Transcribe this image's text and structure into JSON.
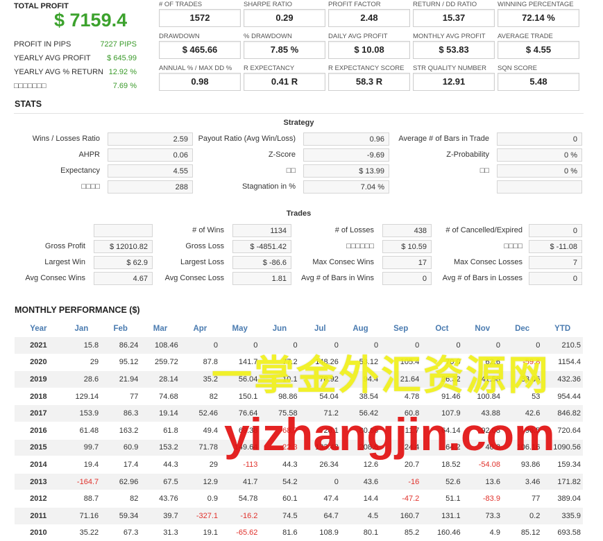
{
  "summary": {
    "total_profit_label": "TOTAL PROFIT",
    "total_profit_value": "$ 7159.4",
    "rows": [
      {
        "label": "PROFIT IN PIPS",
        "value": "7227 PIPS"
      },
      {
        "label": "YEARLY AVG PROFIT",
        "value": "$ 645.99"
      },
      {
        "label": "YEARLY AVG % RETURN",
        "value": "12.92 %"
      },
      {
        "label": "□□□□□□□",
        "value": "7.69 %"
      }
    ]
  },
  "metrics": [
    {
      "label": "# OF TRADES",
      "value": "1572"
    },
    {
      "label": "SHARPE RATIO",
      "value": "0.29"
    },
    {
      "label": "PROFIT FACTOR",
      "value": "2.48"
    },
    {
      "label": "RETURN / DD RATIO",
      "value": "15.37"
    },
    {
      "label": "WINNING PERCENTAGE",
      "value": "72.14 %"
    },
    {
      "label": "DRAWDOWN",
      "value": "$ 465.66"
    },
    {
      "label": "% DRAWDOWN",
      "value": "7.85 %"
    },
    {
      "label": "DAILY AVG PROFIT",
      "value": "$ 10.08"
    },
    {
      "label": "MONTHLY AVG PROFIT",
      "value": "$ 53.83"
    },
    {
      "label": "AVERAGE TRADE",
      "value": "$ 4.55"
    },
    {
      "label": "ANNUAL % / MAX DD %",
      "value": "0.98"
    },
    {
      "label": "R EXPECTANCY",
      "value": "0.41 R"
    },
    {
      "label": "R EXPECTANCY SCORE",
      "value": "58.3 R"
    },
    {
      "label": "STR QUALITY NUMBER",
      "value": "12.91"
    },
    {
      "label": "SQN SCORE",
      "value": "5.48"
    }
  ],
  "stats_title": "STATS",
  "strategy": {
    "title": "Strategy",
    "rows": [
      [
        {
          "label": "Wins / Losses Ratio",
          "value": "2.59"
        },
        {
          "label": "Payout Ratio (Avg Win/Loss)",
          "value": "0.96"
        },
        {
          "label": "Average # of Bars in Trade",
          "value": "0"
        }
      ],
      [
        {
          "label": "AHPR",
          "value": "0.06"
        },
        {
          "label": "Z-Score",
          "value": "-9.69"
        },
        {
          "label": "Z-Probability",
          "value": "0 %"
        }
      ],
      [
        {
          "label": "Expectancy",
          "value": "4.55"
        },
        {
          "label": "□□",
          "value": "$ 13.99"
        },
        {
          "label": "□□",
          "value": "0 %"
        }
      ],
      [
        {
          "label": "□□□□",
          "value": "288"
        },
        {
          "label": "Stagnation in %",
          "value": "7.04 %"
        },
        {
          "label": "",
          "value": ""
        }
      ]
    ]
  },
  "trades": {
    "title": "Trades",
    "rows": [
      [
        {
          "label": "",
          "value": ""
        },
        {
          "label": "# of Wins",
          "value": "1134"
        },
        {
          "label": "# of Losses",
          "value": "438"
        },
        {
          "label": "# of Cancelled/Expired",
          "value": "0"
        }
      ],
      [
        {
          "label": "Gross Profit",
          "value": "$ 12010.82"
        },
        {
          "label": "Gross Loss",
          "value": "$ -4851.42"
        },
        {
          "label": "□□□□□□",
          "value": "$ 10.59"
        },
        {
          "label": "□□□□",
          "value": "$ -11.08"
        }
      ],
      [
        {
          "label": "Largest Win",
          "value": "$ 62.9"
        },
        {
          "label": "Largest Loss",
          "value": "$ -86.6"
        },
        {
          "label": "Max Consec Wins",
          "value": "17"
        },
        {
          "label": "Max Consec Losses",
          "value": "7"
        }
      ],
      [
        {
          "label": "Avg Consec Wins",
          "value": "4.67"
        },
        {
          "label": "Avg Consec Loss",
          "value": "1.81"
        },
        {
          "label": "Avg # of Bars in Wins",
          "value": "0"
        },
        {
          "label": "Avg # of Bars in Losses",
          "value": "0"
        }
      ]
    ]
  },
  "monthly": {
    "title": "MONTHLY PERFORMANCE ($)",
    "columns": [
      "Year",
      "Jan",
      "Feb",
      "Mar",
      "Apr",
      "May",
      "Jun",
      "Jul",
      "Aug",
      "Sep",
      "Oct",
      "Nov",
      "Dec",
      "YTD"
    ],
    "rows": [
      [
        "2021",
        "15.8",
        "86.24",
        "108.46",
        "0",
        "0",
        "0",
        "0",
        "0",
        "0",
        "0",
        "0",
        "0",
        "210.5"
      ],
      [
        "2020",
        "29",
        "95.12",
        "259.72",
        "87.8",
        "141.7",
        "77.2",
        "148.26",
        "53.12",
        "105.4",
        "70.0",
        "62.6",
        "-59.8",
        "1154.4"
      ],
      [
        "2019",
        "28.6",
        "21.94",
        "28.14",
        "35.2",
        "56.04",
        "10.1",
        "78.92",
        "94.4",
        "21.64",
        "26.32",
        "41.58",
        "33.06",
        "432.36"
      ],
      [
        "2018",
        "129.14",
        "77",
        "74.68",
        "82",
        "150.1",
        "98.86",
        "54.04",
        "38.54",
        "4.78",
        "91.46",
        "100.84",
        "53",
        "954.44"
      ],
      [
        "2017",
        "153.9",
        "86.3",
        "19.14",
        "52.46",
        "76.64",
        "75.58",
        "71.2",
        "56.42",
        "60.8",
        "107.9",
        "43.88",
        "42.6",
        "846.82"
      ],
      [
        "2016",
        "61.48",
        "163.2",
        "61.8",
        "49.4",
        "69.38",
        "-68.7",
        "28.1",
        "80.66",
        "11.7",
        "64.14",
        "92.08",
        "96.5",
        "720.64"
      ],
      [
        "2015",
        "99.7",
        "60.9",
        "153.2",
        "71.78",
        "149.64",
        "-22.3",
        "133.48",
        "208.6",
        "24.4",
        "64.2",
        "40.8",
        "106.16",
        "1090.56"
      ],
      [
        "2014",
        "19.4",
        "17.4",
        "44.3",
        "29",
        "-113",
        "44.3",
        "26.34",
        "12.6",
        "20.7",
        "18.52",
        "-54.08",
        "93.86",
        "159.34"
      ],
      [
        "2013",
        "-164.7",
        "62.96",
        "67.5",
        "12.9",
        "41.7",
        "54.2",
        "0",
        "43.6",
        "-16",
        "52.6",
        "13.6",
        "3.46",
        "171.82"
      ],
      [
        "2012",
        "88.7",
        "82",
        "43.76",
        "0.9",
        "54.78",
        "60.1",
        "47.4",
        "14.4",
        "-47.2",
        "51.1",
        "-83.9",
        "77",
        "389.04"
      ],
      [
        "2011",
        "71.16",
        "59.34",
        "39.7",
        "-327.1",
        "-16.2",
        "74.5",
        "64.7",
        "4.5",
        "160.7",
        "131.1",
        "73.3",
        "0.2",
        "335.9"
      ],
      [
        "2010",
        "35.22",
        "67.3",
        "31.3",
        "19.1",
        "-65.62",
        "81.6",
        "108.9",
        "80.1",
        "85.2",
        "160.46",
        "4.9",
        "85.12",
        "693.58"
      ]
    ]
  },
  "watermark": {
    "chinese": "一掌金外汇资源网",
    "latin": "yizhangjin.com"
  }
}
